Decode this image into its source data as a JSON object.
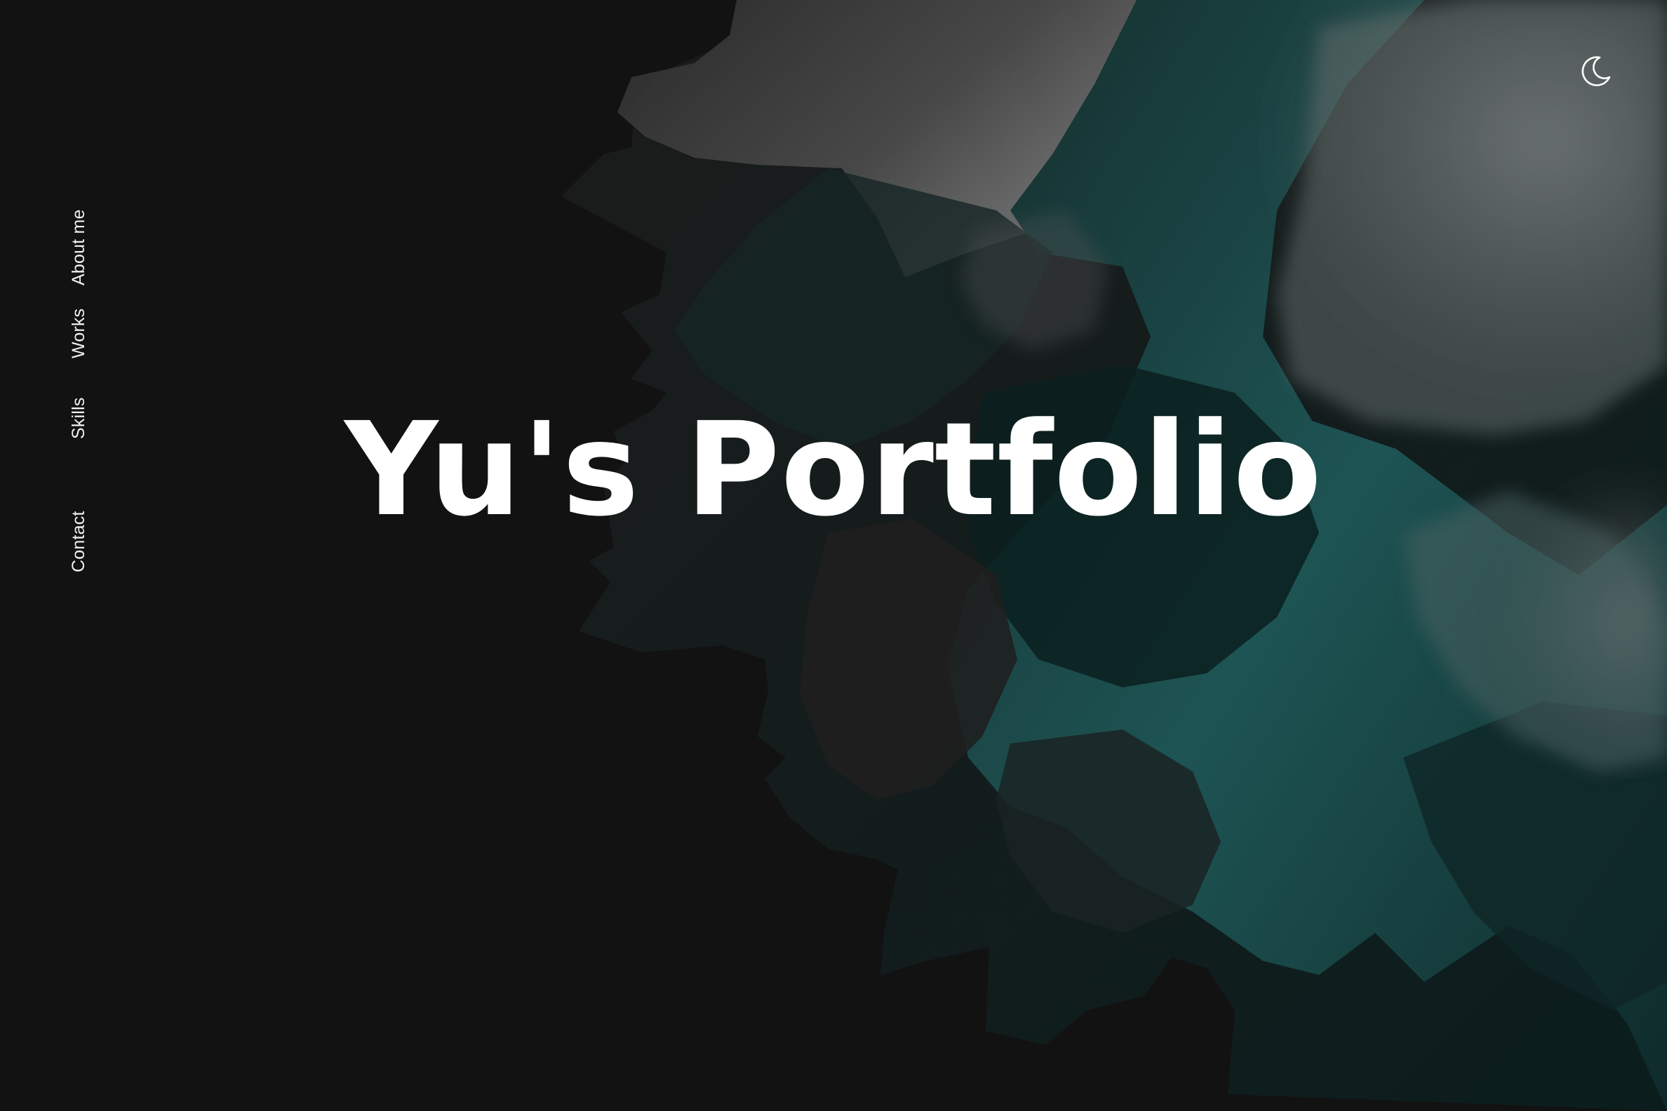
{
  "nav": {
    "items": [
      {
        "label": "About me"
      },
      {
        "label": "Works"
      },
      {
        "label": "Skills"
      },
      {
        "label": "Contact"
      }
    ]
  },
  "hero": {
    "title": "Yu's Portfolio"
  },
  "theme_toggle": {
    "icon": "moon-icon"
  },
  "colors": {
    "background": "#121212",
    "text": "#ffffff",
    "accent_teal": "#1d5a5a",
    "haze_gray": "#7a7a7a"
  }
}
